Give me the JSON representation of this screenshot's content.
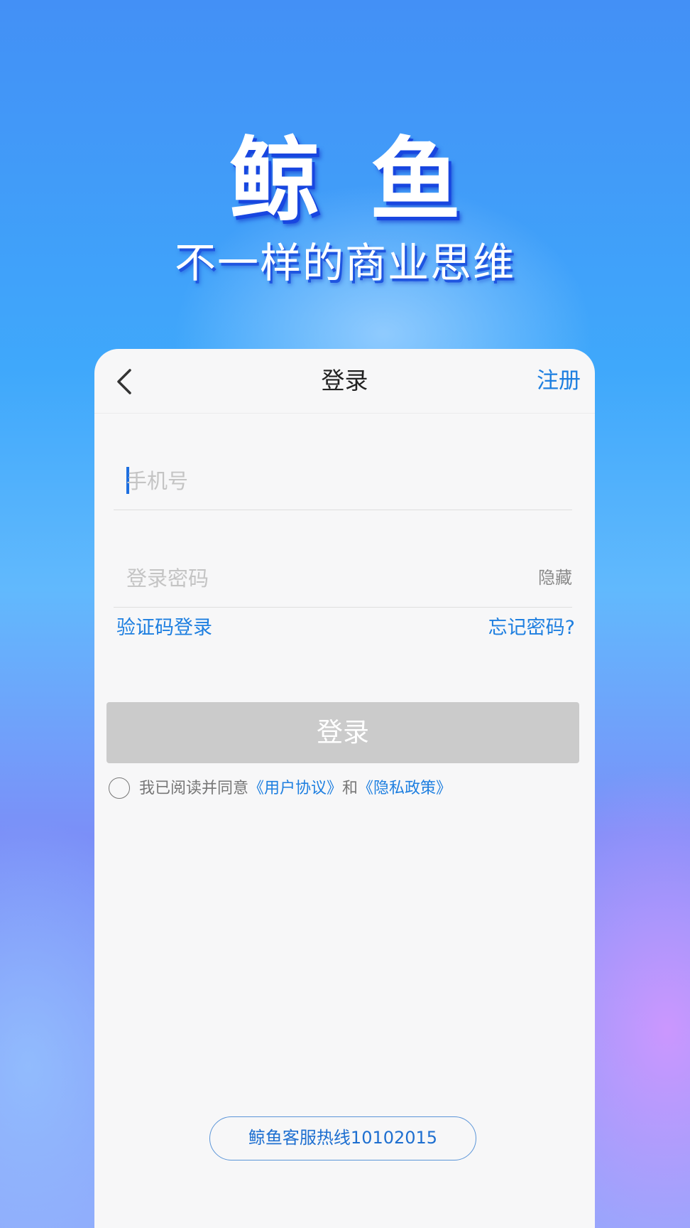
{
  "hero": {
    "title": "鲸鱼",
    "subtitle": "不一样的商业思维"
  },
  "header": {
    "back_icon": "chevron-left-icon",
    "title": "登录",
    "register_label": "注册"
  },
  "form": {
    "phone_placeholder": "手机号",
    "phone_value": "",
    "password_placeholder": "登录密码",
    "password_value": "",
    "hide_label": "隐藏",
    "sms_login_label": "验证码登录",
    "forgot_label": "忘记密码?",
    "login_button_label": "登录"
  },
  "agreement": {
    "prefix": "我已阅读并同意",
    "user_agreement": "《用户协议》",
    "conjunction": "和",
    "privacy_policy": "《隐私政策》",
    "checked": false
  },
  "hotline": {
    "label": "鲸鱼客服热线10102015"
  },
  "colors": {
    "accent": "#1e7fe0",
    "button_disabled": "#cbcbcb",
    "card_bg": "#f7f7f8"
  }
}
